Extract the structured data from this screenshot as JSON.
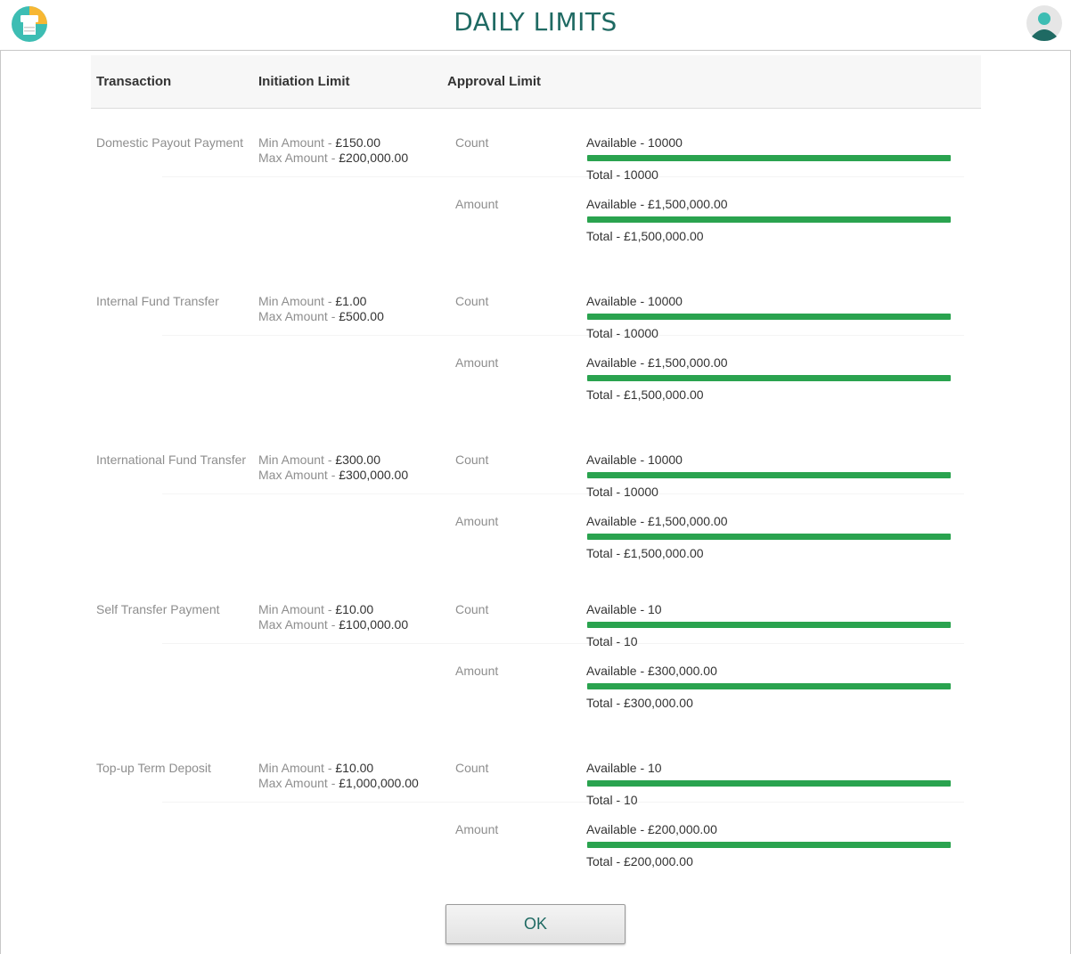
{
  "header": {
    "title": "DAILY LIMITS"
  },
  "columns": {
    "transaction": "Transaction",
    "initiation": "Initiation Limit",
    "approval": "Approval Limit"
  },
  "labels": {
    "min": "Min Amount - ",
    "max": "Max Amount - ",
    "count": "Count",
    "amount": "Amount"
  },
  "colors": {
    "accent": "#1f6a63",
    "bar": "#2aa34f"
  },
  "rows": [
    {
      "name": "Domestic Payout Payment",
      "min": "£150.00",
      "max": "£200,000.00",
      "count_available": "Available - 10000",
      "count_total": "Total - 10000",
      "amount_available": "Available - £1,500,000.00",
      "amount_total": "Total - £1,500,000.00",
      "count_fraction": 1.0,
      "amount_fraction": 1.0
    },
    {
      "name": "Internal Fund Transfer",
      "min": "£1.00",
      "max": "£500.00",
      "count_available": "Available - 10000",
      "count_total": "Total - 10000",
      "amount_available": "Available - £1,500,000.00",
      "amount_total": "Total - £1,500,000.00",
      "count_fraction": 1.0,
      "amount_fraction": 1.0
    },
    {
      "name": "International Fund Transfer",
      "min": "£300.00",
      "max": "£300,000.00",
      "count_available": "Available - 10000",
      "count_total": "Total - 10000",
      "amount_available": "Available - £1,500,000.00",
      "amount_total": "Total - £1,500,000.00",
      "count_fraction": 1.0,
      "amount_fraction": 1.0
    },
    {
      "name": "Self Transfer Payment",
      "min": "£10.00",
      "max": "£100,000.00",
      "count_available": "Available - 10",
      "count_total": "Total - 10",
      "amount_available": "Available - £300,000.00",
      "amount_total": "Total - £300,000.00",
      "count_fraction": 1.0,
      "amount_fraction": 1.0
    },
    {
      "name": "Top-up Term Deposit",
      "min": "£10.00",
      "max": "£1,000,000.00",
      "count_available": "Available - 10",
      "count_total": "Total - 10",
      "amount_available": "Available - £200,000.00",
      "amount_total": "Total - £200,000.00",
      "count_fraction": 1.0,
      "amount_fraction": 1.0
    }
  ],
  "footer": {
    "ok_label": "OK"
  }
}
